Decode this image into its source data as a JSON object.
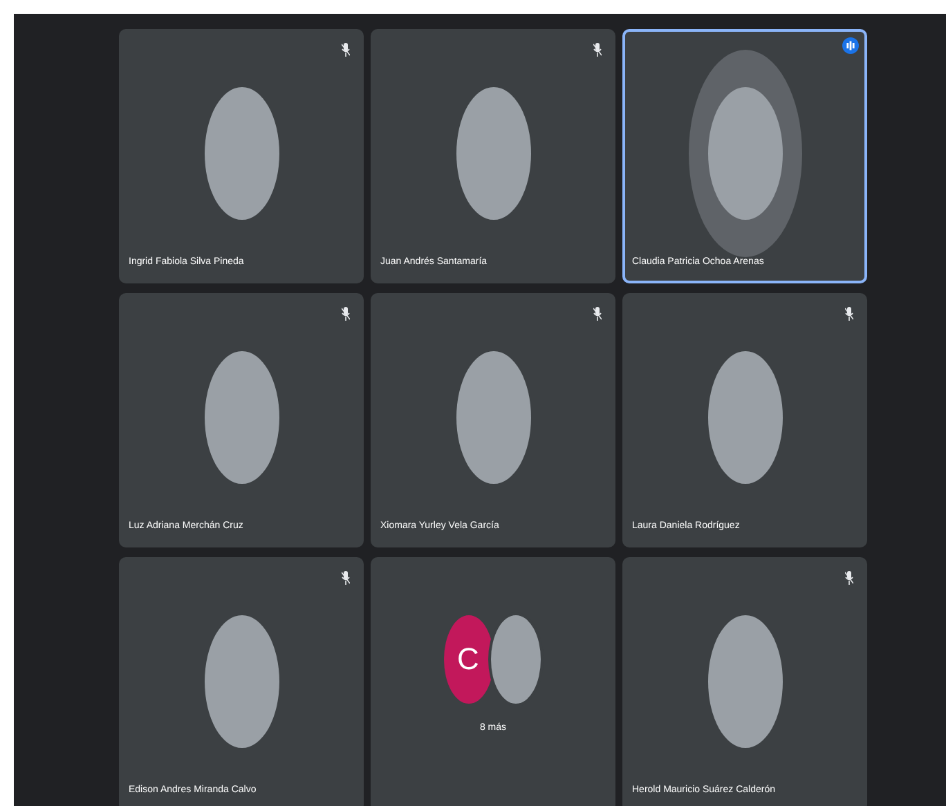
{
  "tiles": [
    {
      "kind": "person",
      "name": "Ingrid Fabiola Silva Pineda",
      "speaking": false
    },
    {
      "kind": "person",
      "name": "Juan Andrés Santamaría",
      "speaking": false
    },
    {
      "kind": "person",
      "name": "Claudia Patricia Ochoa Arenas",
      "speaking": true
    },
    {
      "kind": "person",
      "name": "Luz Adriana Merchán Cruz",
      "speaking": false
    },
    {
      "kind": "person",
      "name": "Xiomara Yurley Vela García",
      "speaking": false
    },
    {
      "kind": "person",
      "name": "Laura Daniela Rodríguez",
      "speaking": false
    },
    {
      "kind": "person",
      "name": "Edison Andres Miranda Calvo",
      "speaking": false
    },
    {
      "kind": "more",
      "initial": "C",
      "count_label": "8 más"
    },
    {
      "kind": "person",
      "name": "Herold Mauricio Suárez Calderón",
      "speaking": false
    }
  ]
}
